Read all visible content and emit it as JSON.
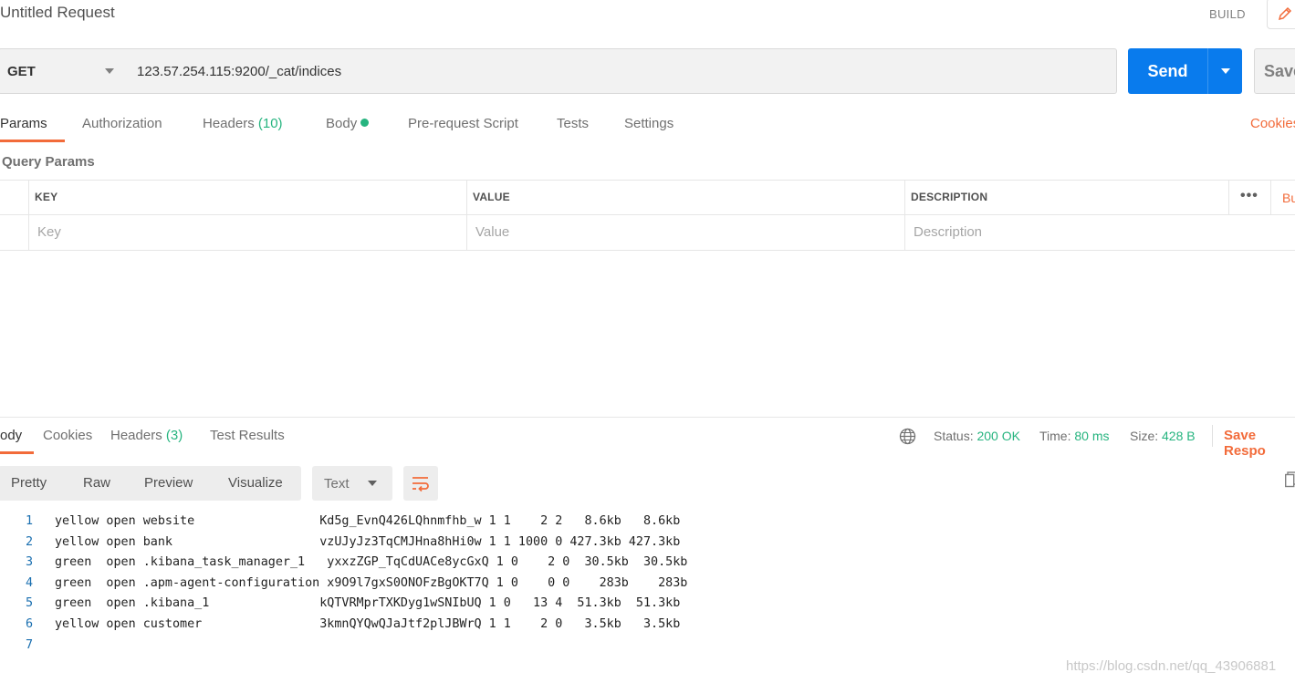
{
  "request": {
    "title": "Untitled Request",
    "build_label": "BUILD",
    "method": "GET",
    "url": "123.57.254.115:9200/_cat/indices",
    "send_label": "Send",
    "save_label": "Save"
  },
  "request_tabs": [
    {
      "label": "Params",
      "active": true
    },
    {
      "label": "Authorization"
    },
    {
      "label": "Headers",
      "count": "(10)"
    },
    {
      "label": "Body"
    },
    {
      "label": "Pre-request Script"
    },
    {
      "label": "Tests"
    },
    {
      "label": "Settings"
    }
  ],
  "cookies_link": "Cookies",
  "query_params": {
    "title": "Query Params",
    "columns": [
      "KEY",
      "VALUE",
      "DESCRIPTION"
    ],
    "more": "•••",
    "bulk_edit": "Bu",
    "placeholders": {
      "key": "Key",
      "value": "Value",
      "description": "Description"
    }
  },
  "response": {
    "tabs": [
      {
        "label": "ody",
        "active": true
      },
      {
        "label": "Cookies"
      },
      {
        "label": "Headers",
        "count": "(3)"
      },
      {
        "label": "Test Results"
      }
    ],
    "status_label": "Status:",
    "status_value": "200 OK",
    "time_label": "Time:",
    "time_value": "80 ms",
    "size_label": "Size:",
    "size_value": "428 B",
    "save_response": "Save Respo",
    "view_options": [
      "Pretty",
      "Raw",
      "Preview",
      "Visualize"
    ],
    "format": "Text",
    "lines": [
      {
        "n": "1",
        "text": "yellow open website                 Kd5g_EvnQ426LQhnmfhb_w 1 1    2 2   8.6kb   8.6kb"
      },
      {
        "n": "2",
        "text": "yellow open bank                    vzUJyJz3TqCMJHna8hHi0w 1 1 1000 0 427.3kb 427.3kb"
      },
      {
        "n": "3",
        "text": "green  open .kibana_task_manager_1   yxxzZGP_TqCdUACe8ycGxQ 1 0    2 0  30.5kb  30.5kb"
      },
      {
        "n": "4",
        "text": "green  open .apm-agent-configuration x9O9l7gxS0ONOFzBgOKT7Q 1 0    0 0    283b    283b"
      },
      {
        "n": "5",
        "text": "green  open .kibana_1               kQTVRMprTXKDyg1wSNIbUQ 1 0   13 4  51.3kb  51.3kb"
      },
      {
        "n": "6",
        "text": "yellow open customer                3kmnQYQwQJaJtf2plJBWrQ 1 1    2 0   3.5kb   3.5kb"
      },
      {
        "n": "7",
        "text": ""
      }
    ]
  },
  "watermark": "https://blog.csdn.net/qq_43906881",
  "colors": {
    "accent": "#f26b3a",
    "send": "#097bed",
    "success": "#26b47f"
  }
}
